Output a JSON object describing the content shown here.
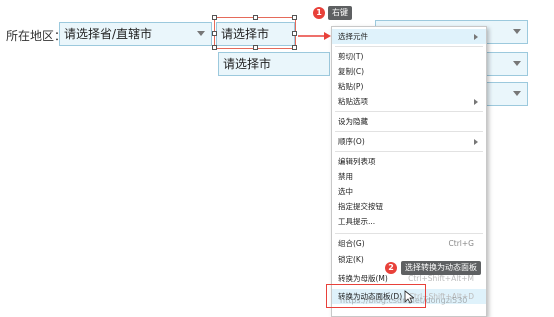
{
  "form": {
    "region_label": "所在地区：",
    "province_select": "请选择省/直辖市",
    "city_select": "请选择市",
    "city_select_2": "请选择市"
  },
  "annotations": {
    "step1_num": "1",
    "step1_tip": "右键",
    "step2_num": "2",
    "step2_tip": "选择转换为动态面板"
  },
  "context_menu": {
    "select_element": "选择元件",
    "cut": "剪切(T)",
    "copy": "复制(C)",
    "paste": "粘贴(P)",
    "paste_options": "粘贴选项",
    "set_hidden": "设为隐藏",
    "order": "顺序(O)",
    "edit_list_items": "编辑列表项",
    "disable": "禁用",
    "selected": "选中",
    "assign_submit_button": "指定提交按钮",
    "tooltip": "工具提示...",
    "group": "组合(G)",
    "group_shortcut": "Ctrl+G",
    "lock": "锁定(K)",
    "convert_master": "转换为母版(M)",
    "convert_master_shortcut": "Ctrl+Shift+Alt+M",
    "convert_dynamic_panel": "转换为动态面板(D)",
    "convert_dynamic_panel_shortcut": "Ctrl+Shift+Alt+D"
  },
  "watermark": "https://blog.csdn.net/dongzi530",
  "colors": {
    "accent_red": "#e8413a",
    "select_bg": "#eaf6fb",
    "select_border": "#9cc9dd",
    "menu_highlight": "#dff2fb"
  }
}
